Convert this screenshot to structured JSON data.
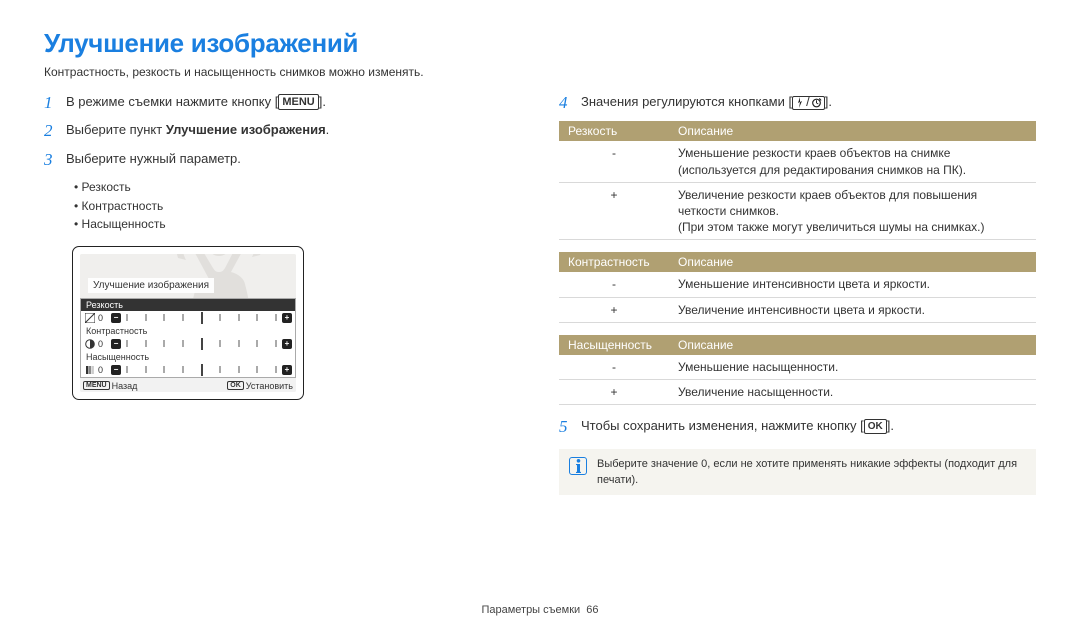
{
  "title": "Улучшение изображений",
  "subtitle": "Контрастность, резкость и насыщенность снимков можно изменять.",
  "steps": {
    "s1_before": "В режиме съемки нажмите кнопку [",
    "s1_button": "MENU",
    "s1_after": "].",
    "s2_before": "Выберите пункт ",
    "s2_bold": "Улучшение изображения",
    "s2_after": ".",
    "s3": "Выберите нужный параметр.",
    "s4_before": "Значения регулируются кнопками [",
    "s4_after": "].",
    "s5_before": "Чтобы сохранить изменения, нажмите кнопку [",
    "s5_button": "OK",
    "s5_after": "]."
  },
  "bullets": [
    "Резкость",
    "Контрастность",
    "Насыщенность"
  ],
  "screen": {
    "tab": "Улучшение изображения",
    "rows": {
      "r1": "Резкость",
      "r2": "Контрастность",
      "r3": "Насыщенность"
    },
    "val": "0",
    "footer_back": "Назад",
    "footer_set": "Установить",
    "menu_mini": "MENU",
    "ok_mini": "OK"
  },
  "tables": {
    "t1": {
      "h1": "Резкость",
      "h2": "Описание",
      "r1a": "-",
      "r1b": "Уменьшение резкости краев объектов на снимке (используется для редактирования снимков на ПК).",
      "r2a": "+",
      "r2b_line1": "Увеличение резкости краев объектов для повышения четкости снимков.",
      "r2b_line2": "(При этом также могут увеличиться шумы на снимках.)"
    },
    "t2": {
      "h1": "Контрастность",
      "h2": "Описание",
      "r1a": "-",
      "r1b": "Уменьшение интенсивности цвета и яркости.",
      "r2a": "+",
      "r2b": "Увеличение интенсивности цвета и яркости."
    },
    "t3": {
      "h1": "Насыщенность",
      "h2": "Описание",
      "r1a": "-",
      "r1b": "Уменьшение насыщенности.",
      "r2a": "+",
      "r2b": "Увеличение насыщенности."
    }
  },
  "note": "Выберите значение 0, если не хотите применять никакие эффекты (подходит для печати).",
  "footer": {
    "label": "Параметры съемки",
    "page": "66"
  }
}
